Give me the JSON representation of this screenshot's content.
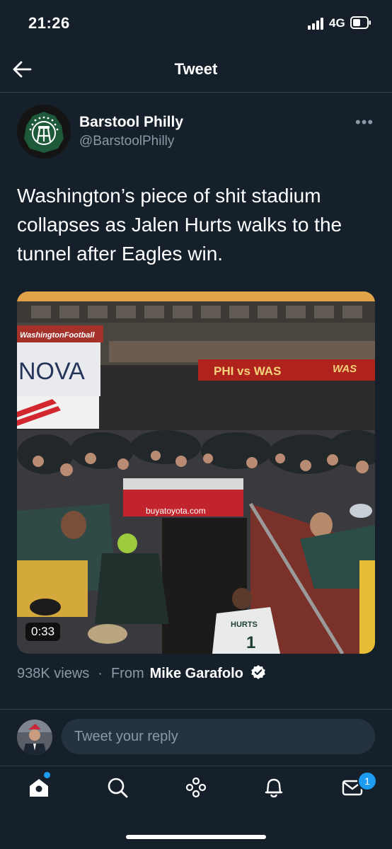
{
  "status_bar": {
    "time": "21:26",
    "network": "4G"
  },
  "header": {
    "title": "Tweet"
  },
  "tweet": {
    "author_name": "Barstool Philly",
    "author_handle": "@BarstoolPhilly",
    "text": "Washington’s piece of shit stadium collapses as Jalen Hurts walks to the tunnel after Eagles win.",
    "video": {
      "duration": "0:33",
      "signage": {
        "banner_left": "WashingtonFootball",
        "board_left": "NOVA",
        "banner_center": "PHI vs WAS",
        "banner_right": "WAS",
        "tunnel_sign": "buyatoyota.com",
        "jersey_name": "HURTS",
        "jersey_number": "1"
      }
    },
    "views": "938K views",
    "separator": "·",
    "from_label": "From",
    "from_source": "Mike Garafolo"
  },
  "reply": {
    "placeholder": "Tweet your reply"
  },
  "tab_bar": {
    "items": [
      "home-icon",
      "search-icon",
      "spaces-icon",
      "notifications-icon",
      "messages-icon"
    ],
    "messages_badge": "1"
  },
  "colors": {
    "background": "#15202b",
    "accent": "#1d9bf0",
    "secondary_text": "#8b98a5"
  }
}
